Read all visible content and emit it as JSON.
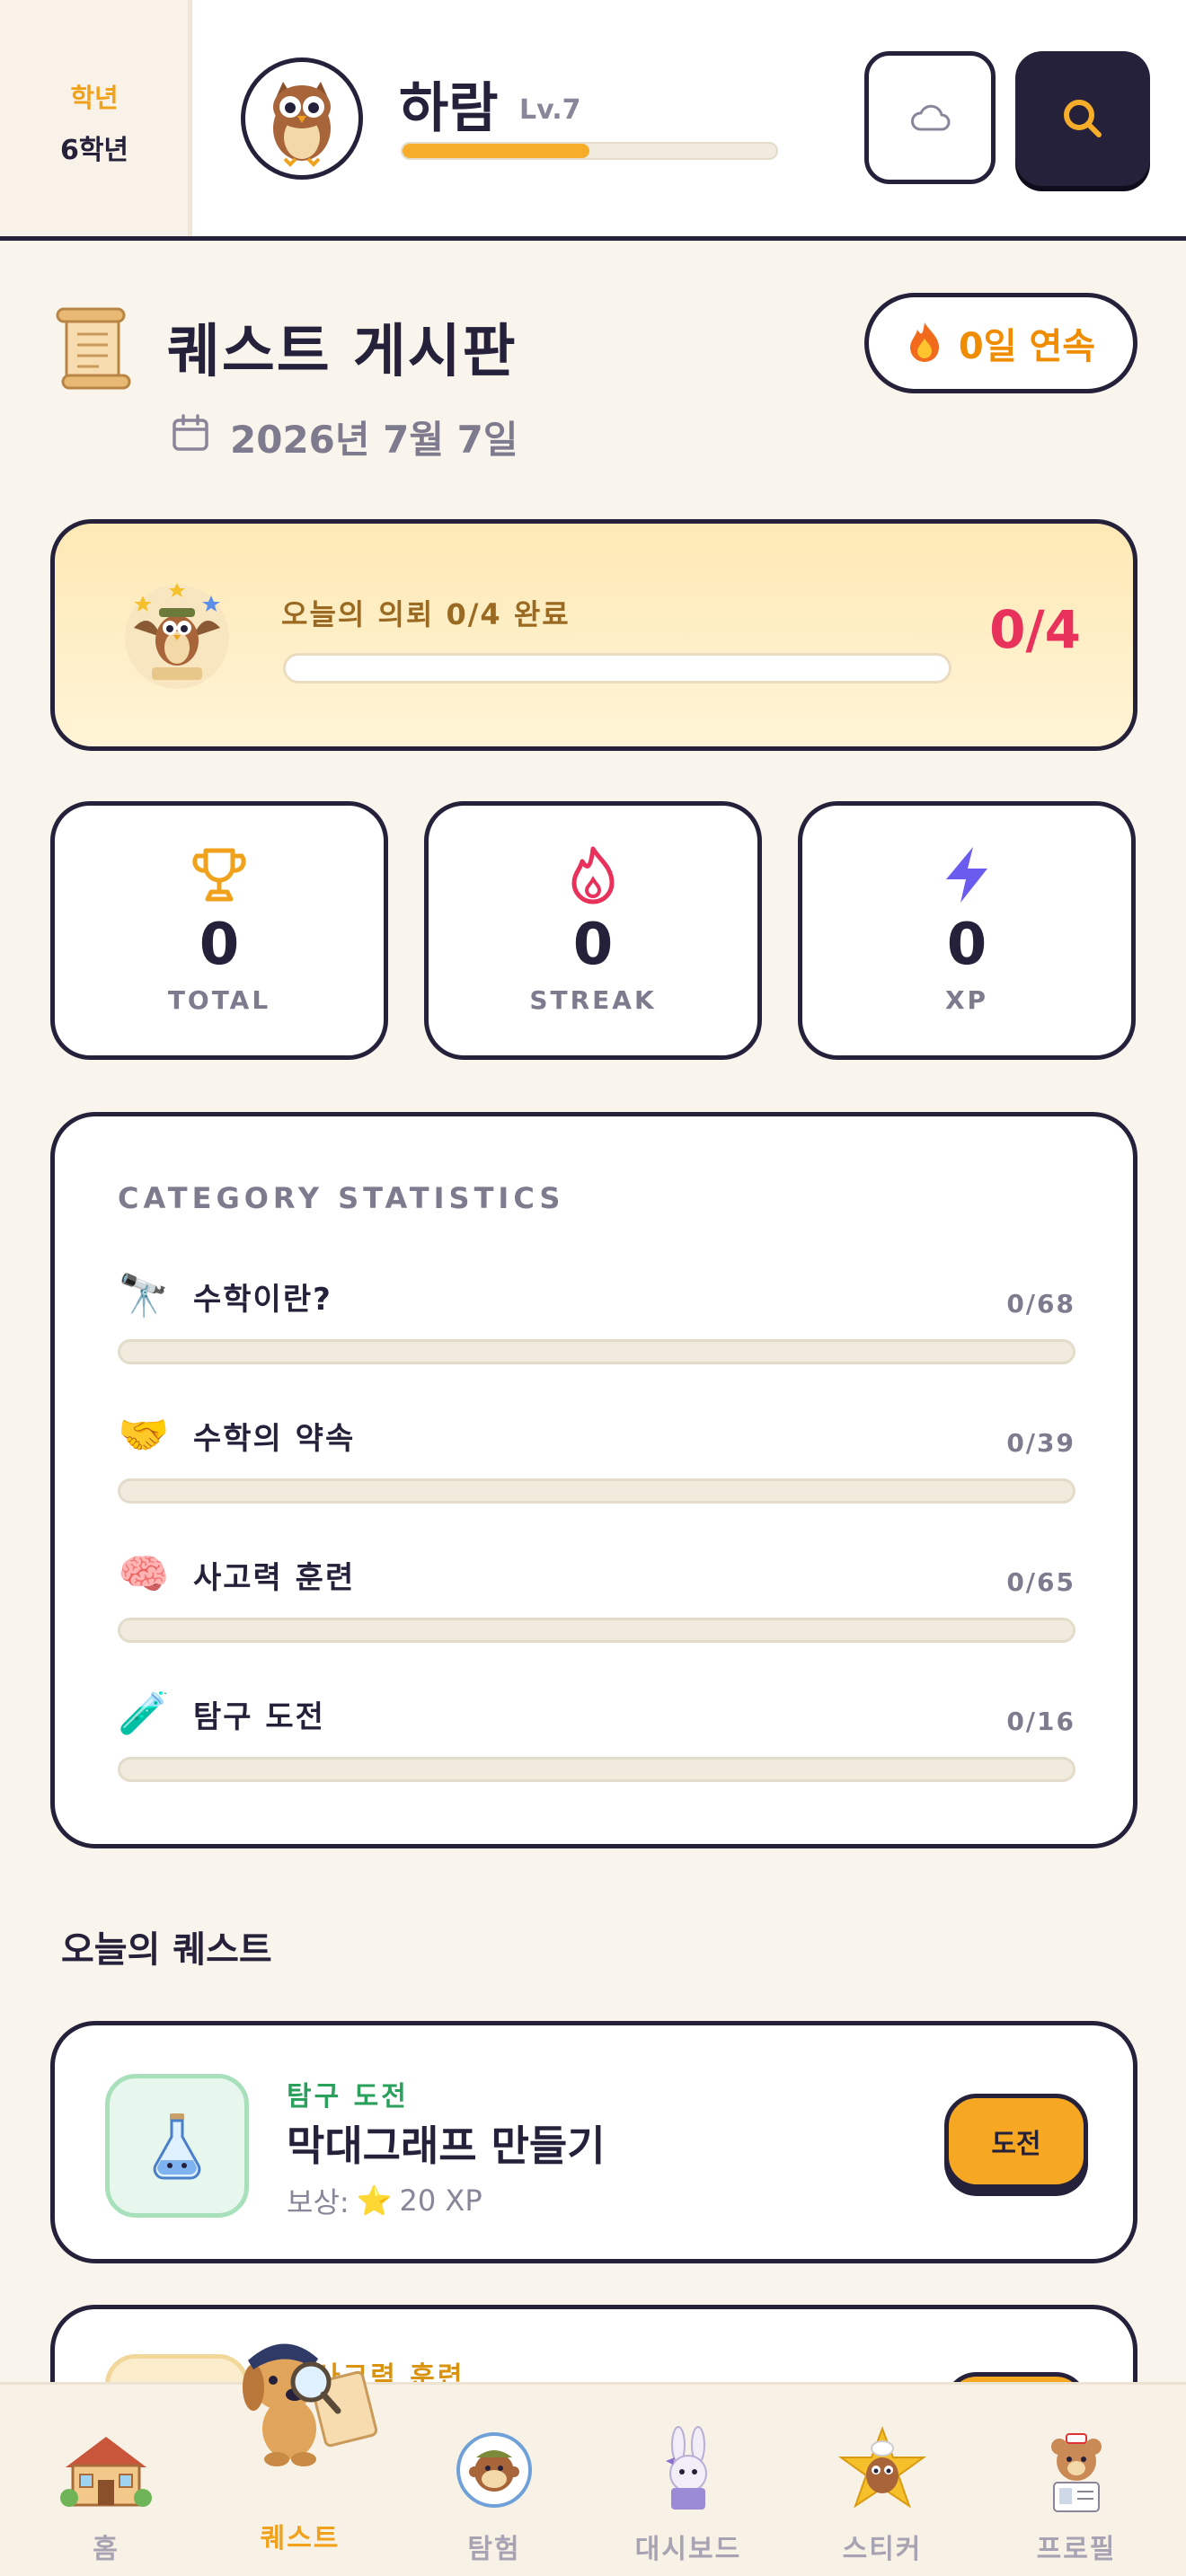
{
  "header": {
    "grade_label": "학년",
    "grade_value": "6학년",
    "username": "하람",
    "level": "Lv.7",
    "xp_progress": 0.5
  },
  "icons": {
    "avatar": "owl-avatar",
    "cloud": "cloud-icon",
    "search": "search-icon",
    "scroll": "scroll-icon",
    "calendar": "calendar-icon",
    "fire": "fire-icon",
    "trophy": "trophy-icon",
    "flame": "flame-icon",
    "bolt": "lightning-icon"
  },
  "page": {
    "title": "퀘스트 게시판",
    "date": "2026년 7월 7일",
    "streak_label": "0일 연속"
  },
  "daily": {
    "label": "오늘의 의뢰 0/4 완료",
    "count": "0/4",
    "progress": 0
  },
  "stats": [
    {
      "value": "0",
      "label": "TOTAL",
      "color": "#f1a21c"
    },
    {
      "value": "0",
      "label": "STREAK",
      "color": "#e8315b"
    },
    {
      "value": "0",
      "label": "XP",
      "color": "#6b5cf0"
    }
  ],
  "categories": {
    "heading": "CATEGORY STATISTICS",
    "items": [
      {
        "emoji": "🔭",
        "name": "수학이란?",
        "count": "0/68",
        "progress": 0
      },
      {
        "emoji": "🤝",
        "name": "수학의 약속",
        "count": "0/39",
        "progress": 0
      },
      {
        "emoji": "🧠",
        "name": "사고력 훈련",
        "count": "0/65",
        "progress": 0
      },
      {
        "emoji": "🧪",
        "name": "탐구 도전",
        "count": "0/16",
        "progress": 0
      }
    ]
  },
  "quests": {
    "section_title": "오늘의 퀘스트",
    "items": [
      {
        "category": "탐구 도전",
        "title": "막대그래프 만들기",
        "reward_label": "보상:",
        "reward_star": "⭐",
        "reward_value": "20 XP",
        "button": "도전"
      },
      {
        "category": "사고력 훈련"
      }
    ]
  },
  "nav": {
    "items": [
      {
        "label": "홈",
        "icon": "house-icon"
      },
      {
        "label": "퀘스트",
        "icon": "detective-dog-icon",
        "active": true
      },
      {
        "label": "탐험",
        "icon": "explorer-monkey-icon"
      },
      {
        "label": "대시보드",
        "icon": "rabbit-dashboard-icon"
      },
      {
        "label": "스티커",
        "icon": "owl-star-icon"
      },
      {
        "label": "프로필",
        "icon": "bear-profile-icon"
      }
    ]
  },
  "colors": {
    "ink": "#25213a",
    "accent": "#f5ad2a",
    "background": "#f9f4ec",
    "danger": "#e8315b",
    "success": "#2aa05c"
  }
}
